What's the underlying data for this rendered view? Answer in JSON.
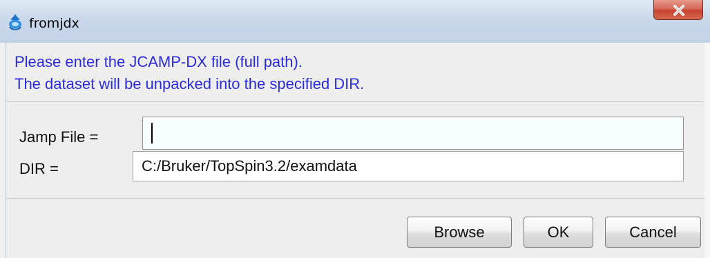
{
  "window": {
    "title": "fromjdx"
  },
  "message": {
    "line1": "Please enter the JCAMP-DX file (full path).",
    "line2": "The dataset will be unpacked into the specified DIR."
  },
  "fields": {
    "jcamp_label": "Jamp File =",
    "jcamp_value": "",
    "dir_label": "DIR =",
    "dir_value": "C:/Bruker/TopSpin3.2/examdata"
  },
  "buttons": {
    "browse": "Browse",
    "ok": "OK",
    "cancel": "Cancel"
  },
  "colors": {
    "message_text": "#2b2bde",
    "close_button": "#c7432f",
    "title_bar": "#c9d8ea"
  },
  "icons": {
    "app": "topspin-app-icon",
    "close": "close-icon"
  }
}
